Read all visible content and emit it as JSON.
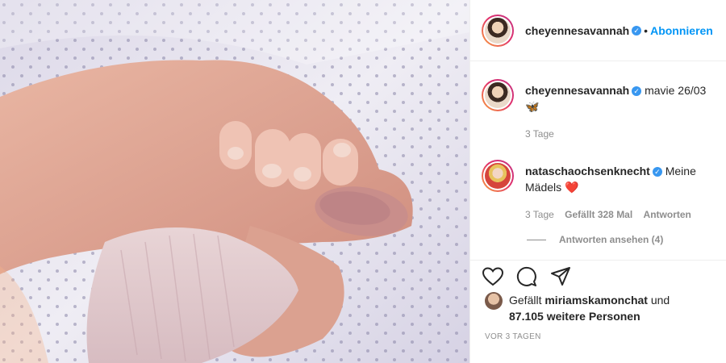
{
  "header": {
    "username": "cheyennesavannah",
    "separator": "•",
    "follow_label": "Abonnieren"
  },
  "caption": {
    "username": "cheyennesavannah",
    "text": "mavie 26/03",
    "emoji": "🦋",
    "time": "3 Tage"
  },
  "comment": {
    "username": "nataschaochsenknecht",
    "text": "Meine Mädels",
    "emoji": "❤️",
    "time": "3 Tage",
    "likes": "Gefällt 328 Mal",
    "reply_label": "Antworten",
    "view_replies": "Antworten ansehen (4)"
  },
  "actions": {
    "like": "heart-icon",
    "comment": "comment-icon",
    "share": "share-icon"
  },
  "likes": {
    "prefix": "Gefällt",
    "user": "miriamskamonchat",
    "connector": "und",
    "count_text": "87.105 weitere Personen"
  },
  "posted": "VOR 3 TAGEN",
  "colors": {
    "accent": "#0095f6",
    "verified": "#3897f0",
    "muted": "#8e8e8e"
  }
}
